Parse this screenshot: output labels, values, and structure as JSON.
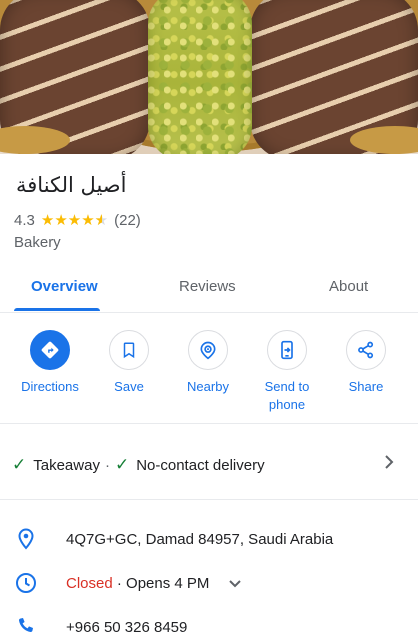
{
  "place": {
    "name": "أصيل الكنافة",
    "rating": "4.3",
    "stars_filled": 4.3,
    "review_count": "(22)",
    "category": "Bakery"
  },
  "tabs": [
    {
      "label": "Overview",
      "active": true
    },
    {
      "label": "Reviews",
      "active": false
    },
    {
      "label": "About",
      "active": false
    }
  ],
  "actions": [
    {
      "label": "Directions",
      "icon": "directions-icon",
      "primary": true
    },
    {
      "label": "Save",
      "icon": "bookmark-icon",
      "primary": false
    },
    {
      "label": "Nearby",
      "icon": "nearby-icon",
      "primary": false
    },
    {
      "label": "Send to phone",
      "icon": "send-to-phone-icon",
      "primary": false
    },
    {
      "label": "Share",
      "icon": "share-icon",
      "primary": false
    }
  ],
  "services": {
    "item1": "Takeaway",
    "separator": "·",
    "item2": "No-contact delivery"
  },
  "info": {
    "address": "4Q7G+GC, Damad 84957, Saudi Arabia",
    "hours_status": "Closed",
    "hours_detail": "· Opens 4 PM",
    "phone": "+966 50 326 8459"
  },
  "colors": {
    "accent": "#1a73e8",
    "star": "#fbbc04",
    "closed": "#d93025",
    "check": "#188038"
  }
}
